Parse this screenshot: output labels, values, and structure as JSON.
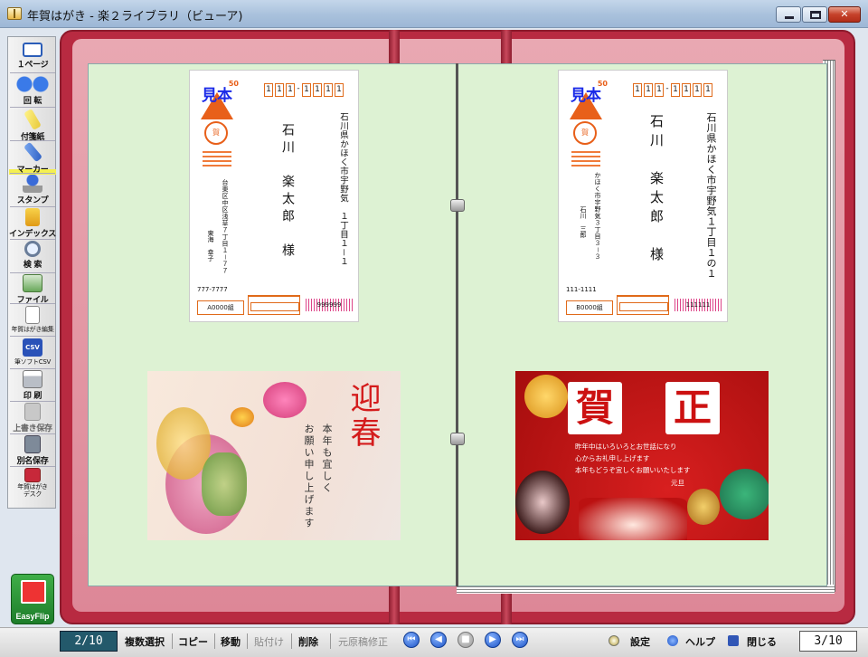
{
  "window": {
    "title": "年賀はがき - 楽２ライブラリ（ビューア)",
    "min_label": "",
    "close_label": "✕"
  },
  "toolbar": {
    "items": [
      {
        "label": "１ページ",
        "icon": "single-page-icon"
      },
      {
        "label": "回 転",
        "icon": "rotate-icon"
      },
      {
        "label": "付箋紙",
        "icon": "sticky-note-icon"
      },
      {
        "label": "マーカー",
        "icon": "marker-icon"
      },
      {
        "label": "スタンプ",
        "icon": "stamp-icon"
      },
      {
        "label": "インデックス",
        "icon": "index-icon"
      },
      {
        "label": "検 索",
        "icon": "search-icon"
      },
      {
        "label": "ファイル",
        "icon": "file-icon"
      },
      {
        "label": "年賀はがき編集",
        "icon": "postcard-edit-icon"
      },
      {
        "label": "筆ソフトCSV",
        "icon": "csv-icon"
      },
      {
        "label": "印 刷",
        "icon": "printer-icon"
      },
      {
        "label": "上書き保存",
        "icon": "save-icon"
      },
      {
        "label": "別名保存",
        "icon": "save-as-icon"
      },
      {
        "label": "年賀はがき\nデスク",
        "icon": "postcard-desk-icon"
      }
    ],
    "logo_text": "EasyFlip",
    "csv_badge": "CSV"
  },
  "left_page": {
    "postcard": {
      "stamp_value": "50",
      "stamp_text": "見本",
      "seal_text": "賀",
      "zip_digits": [
        "1",
        "1",
        "1",
        "-",
        "1",
        "1",
        "1",
        "1"
      ],
      "recipient_address": "石川県かほく市宇野気　１丁目１－１",
      "recipient_name": "石川　楽太郎　様",
      "sender_address": "台東区中区浅草７丁目１－７７",
      "sender_name": "東海　幸子",
      "sender_zip": "777-7777",
      "logo_box": "A0000組",
      "barcode_text": "999999"
    },
    "card": {
      "big_text": "迎春",
      "message": [
        "本年も宜しく",
        "お願い申し上げます"
      ]
    }
  },
  "right_page": {
    "postcard": {
      "stamp_value": "50",
      "stamp_text": "見本",
      "seal_text": "賀",
      "zip_digits": [
        "1",
        "1",
        "1",
        "-",
        "1",
        "1",
        "1",
        "1"
      ],
      "recipient_address": "石川県かほく市宇野気１丁目１の１",
      "recipient_name": "石川　楽太郎　様",
      "sender_address": "かほく市宇野気３丁目３－３",
      "sender_name": "石川　三郎",
      "sender_zip": "111-1111",
      "logo_box": "B0000組",
      "barcode_text": "111111"
    },
    "card": {
      "char1": "賀",
      "char2": "正",
      "greeting": [
        "昨年中はいろいろとお世話になり",
        "心からお礼申し上げます",
        "本年もどうぞ宜しくお願いいたします",
        "元旦"
      ]
    }
  },
  "statusbar": {
    "left_page_indicator": "2/10",
    "right_page_indicator": "3/10",
    "buttons": {
      "multi_select": "複数選択",
      "copy": "コピー",
      "move": "移動",
      "paste": "貼付け",
      "delete": "削除",
      "restore": "元原稿修正",
      "settings": "設定",
      "help": "ヘルプ",
      "close": "閉じる"
    },
    "nav_glyphs": {
      "first": "⏮",
      "prev": "◀",
      "stop": "■",
      "next": "▶",
      "last": "⏭"
    }
  },
  "colors": {
    "book_frame": "#b82a41",
    "page_bg": "#ddf2d3",
    "page_indicator_bg": "#23596b",
    "stamp_orange": "#e8601a",
    "stamp_blue": "#1a2ae8"
  }
}
